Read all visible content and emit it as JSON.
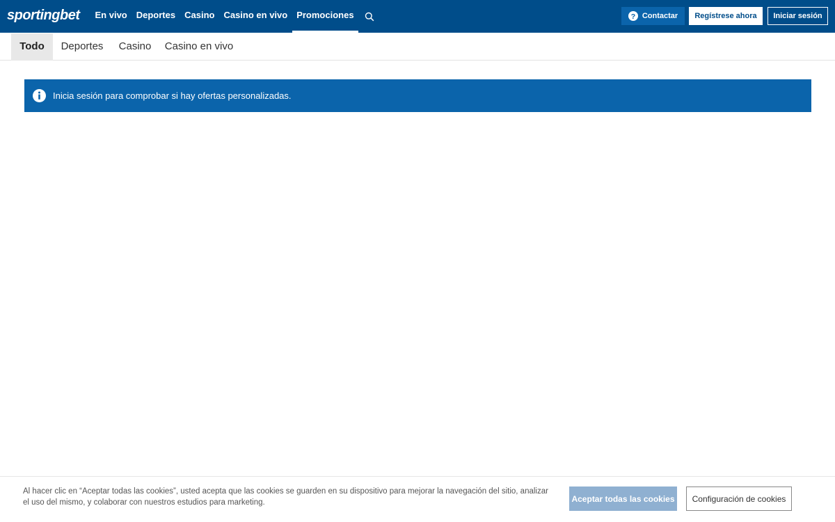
{
  "header": {
    "logo_text": "sportingbet",
    "nav": [
      {
        "label": "En vivo"
      },
      {
        "label": "Deportes"
      },
      {
        "label": "Casino"
      },
      {
        "label": "Casino en vivo"
      },
      {
        "label": "Promociones",
        "active": true
      }
    ],
    "search_icon": "search-icon",
    "contact_label": "Contactar",
    "register_label": "Regístrese ahora",
    "login_label": "Iniciar sesión"
  },
  "tabs": [
    {
      "label": "Todo",
      "active": true
    },
    {
      "label": "Deportes"
    },
    {
      "label": "Casino"
    },
    {
      "label": "Casino en vivo"
    }
  ],
  "info_banner": {
    "icon": "info-icon",
    "text": "Inicia sesión para comprobar si hay ofertas personalizadas."
  },
  "cookie_bar": {
    "text": "Al hacer clic en “Aceptar todas las cookies”, usted acepta que las cookies se guarden en su dispositivo para mejorar la navegación del sitio, analizar el uso del mismo, y colaborar con nuestros estudios para marketing.",
    "accept_label": "Aceptar todas las cookies",
    "settings_label": "Configuración de cookies"
  },
  "colors": {
    "header_bg": "#004d8a",
    "banner_bg": "#0b64ab",
    "accept_bg": "#8fb0d1"
  }
}
